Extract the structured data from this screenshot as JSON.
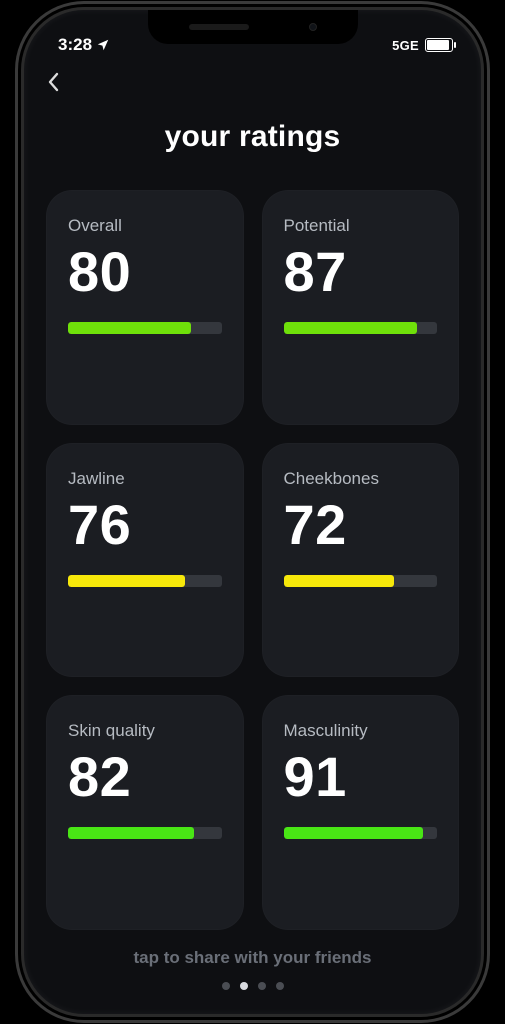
{
  "status": {
    "time": "3:28",
    "network": "5GE"
  },
  "title": "your ratings",
  "footer": "tap to share with your friends",
  "colors": {
    "green": "#6fe00a",
    "yellow": "#f7e80a",
    "bright_green": "#49e615"
  },
  "cards": [
    {
      "label": "Overall",
      "value": "80",
      "pct": 80,
      "color": "#6fe00a"
    },
    {
      "label": "Potential",
      "value": "87",
      "pct": 87,
      "color": "#6fe00a"
    },
    {
      "label": "Jawline",
      "value": "76",
      "pct": 76,
      "color": "#f7e80a"
    },
    {
      "label": "Cheekbones",
      "value": "72",
      "pct": 72,
      "color": "#f7e80a"
    },
    {
      "label": "Skin quality",
      "value": "82",
      "pct": 82,
      "color": "#49e615"
    },
    {
      "label": "Masculinity",
      "value": "91",
      "pct": 91,
      "color": "#49e615"
    }
  ],
  "pager": {
    "count": 4,
    "active": 1
  }
}
